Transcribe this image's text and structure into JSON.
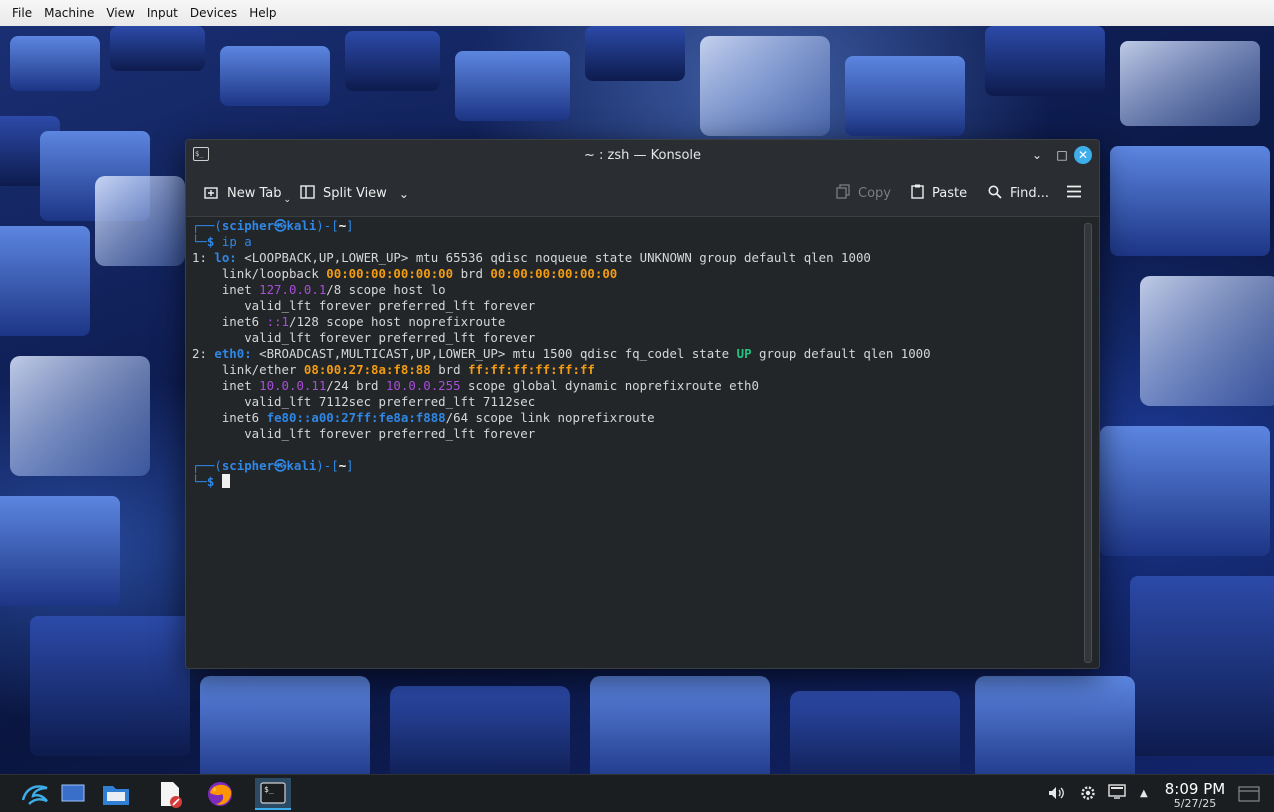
{
  "vm_menu": [
    "File",
    "Machine",
    "View",
    "Input",
    "Devices",
    "Help"
  ],
  "window": {
    "title": "~ : zsh — Konsole",
    "app_icon": "terminal-icon"
  },
  "toolbar": {
    "new_tab": "New Tab",
    "split_view": "Split View",
    "copy": "Copy",
    "paste": "Paste",
    "find": "Find..."
  },
  "terminal": {
    "user": "scipher",
    "host": "kali",
    "cwd": "~",
    "command": "ip a",
    "lo": {
      "header": "1: lo: <LOOPBACK,UP,LOWER_UP> mtu 65536 qdisc noqueue state UNKNOWN group default qlen 1000",
      "mac": "00:00:00:00:00:00",
      "brd": "00:00:00:00:00:00",
      "inet": "127.0.0.1",
      "inet_suffix": "/8 scope host lo",
      "inet6": "::1",
      "inet6_suffix": "/128 scope host noprefixroute",
      "valid": "valid_lft forever preferred_lft forever"
    },
    "eth0": {
      "flags": "<BROADCAST,MULTICAST,UP,LOWER_UP> mtu 1500 qdisc fq_codel state",
      "state": "UP",
      "tail": "group default qlen 1000",
      "mac": "08:00:27:8a:f8:88",
      "brd": "ff:ff:ff:ff:ff:ff",
      "inet": "10.0.0.11",
      "inet_mid": "/24 brd",
      "inet_brd": "10.0.0.255",
      "inet_tail": "scope global dynamic noprefixroute eth0",
      "valid_inet": "valid_lft 7112sec preferred_lft 7112sec",
      "inet6": "fe80::a00:27ff:fe8a:f888",
      "inet6_tail": "/64 scope link noprefixroute",
      "valid_inet6": "valid_lft forever preferred_lft forever"
    }
  },
  "taskbar": {
    "apps": [
      "kali-menu-icon",
      "desktop-pager-icon",
      "file-manager-icon",
      "text-editor-icon",
      "firefox-icon",
      "konsole-icon"
    ],
    "time": "8:09 PM",
    "date": "5/27/25"
  },
  "colors": {
    "accent": "#3daee9",
    "prompt_blue": "#2f87e6",
    "ip_purple": "#a74ed8",
    "mac_orange": "#f39c12",
    "state_green": "#26c281"
  }
}
